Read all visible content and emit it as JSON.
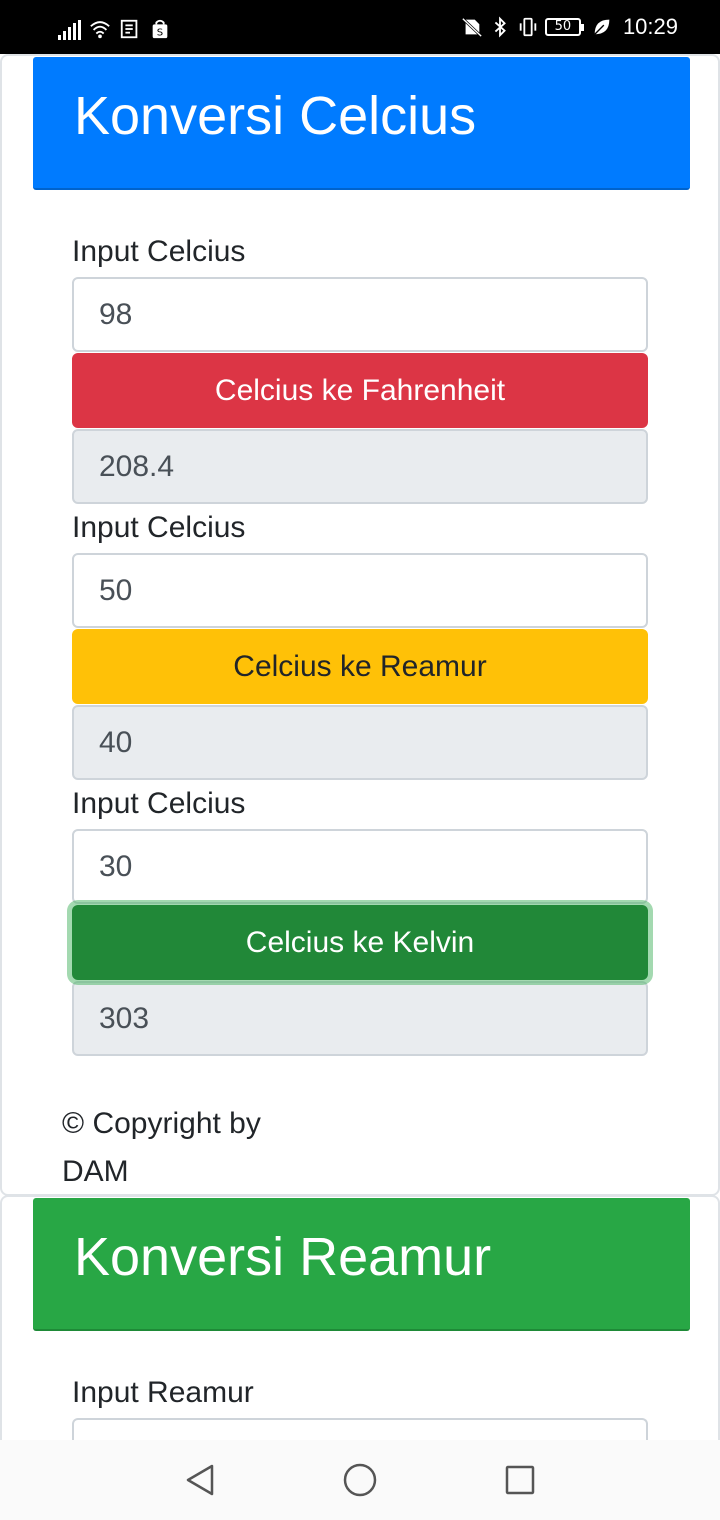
{
  "status_bar": {
    "icons": [
      "signal-icon",
      "wifi-icon",
      "notification-icon",
      "shop-icon",
      "no-sim-icon",
      "bluetooth-icon",
      "vibrate-icon",
      "battery-icon",
      "leaf-icon"
    ],
    "battery": "50",
    "time": "10:29"
  },
  "celcius": {
    "title": "Konversi Celcius",
    "header_color": "#007bff",
    "fahrenheit": {
      "label": "Input Celcius",
      "input": "98",
      "button": "Celcius ke Fahrenheit",
      "result": "208.4"
    },
    "reamur": {
      "label": "Input Celcius",
      "input": "50",
      "button": "Celcius ke Reamur",
      "result": "40"
    },
    "kelvin": {
      "label": "Input Celcius",
      "input": "30",
      "button": "Celcius ke Kelvin",
      "result": "303"
    },
    "footer_line1": "© Copyright by",
    "footer_line2": "DAM"
  },
  "reamur_section": {
    "title": "Konversi Reamur",
    "header_color": "#28a745",
    "label": "Input Reamur"
  },
  "nav_bar": {
    "icons": [
      "back-icon",
      "home-icon",
      "recents-icon"
    ]
  }
}
